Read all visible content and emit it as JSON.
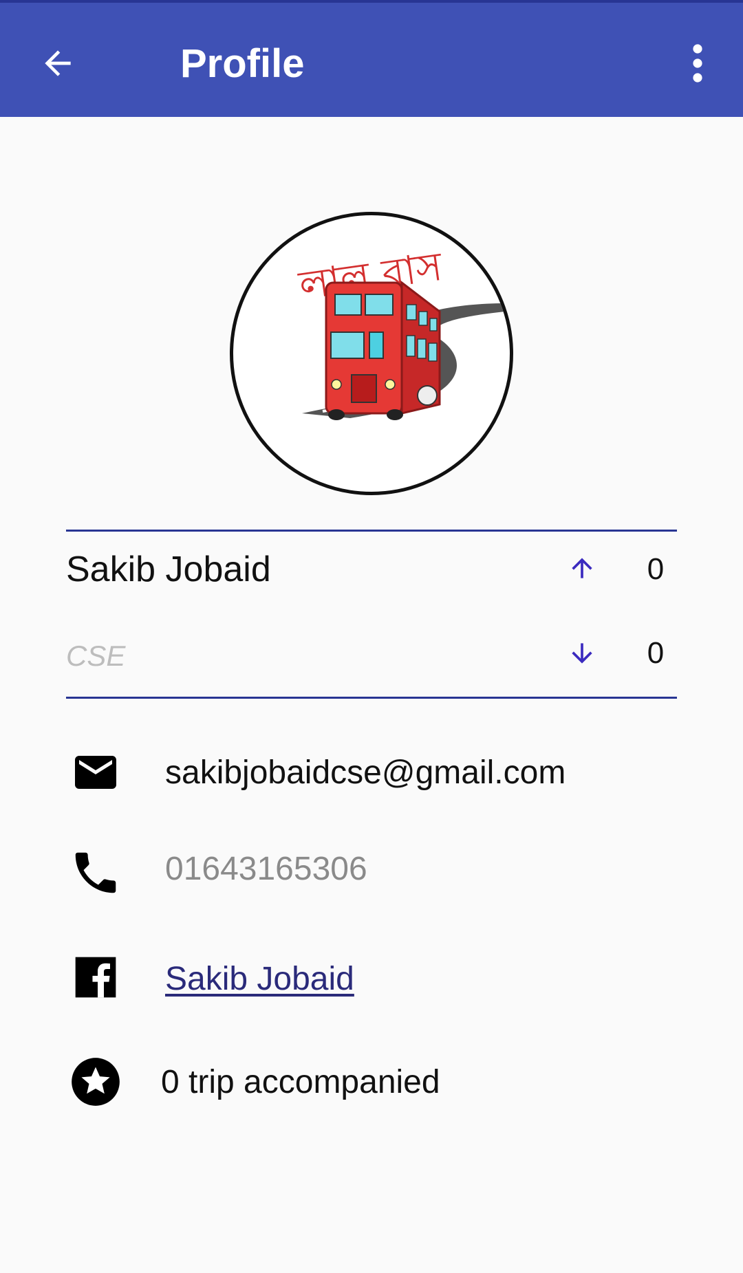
{
  "app_bar": {
    "title": "Profile",
    "back_icon": "arrow-back-icon",
    "menu_icon": "more-vert-icon",
    "background_color": "#3f51b5"
  },
  "profile": {
    "avatar_logo_text": "লাল বাস",
    "name": "Sakib Jobaid",
    "department": "CSE",
    "upvotes": "0",
    "downvotes": "0"
  },
  "contact": {
    "email": "sakibjobaidcse@gmail.com",
    "phone": "01643165306",
    "facebook": "Sakib Jobaid",
    "trips": "0 trip accompanied"
  },
  "colors": {
    "accent": "#283593",
    "vote_arrow": "#3b2bbf",
    "link": "#2a2a7a"
  }
}
